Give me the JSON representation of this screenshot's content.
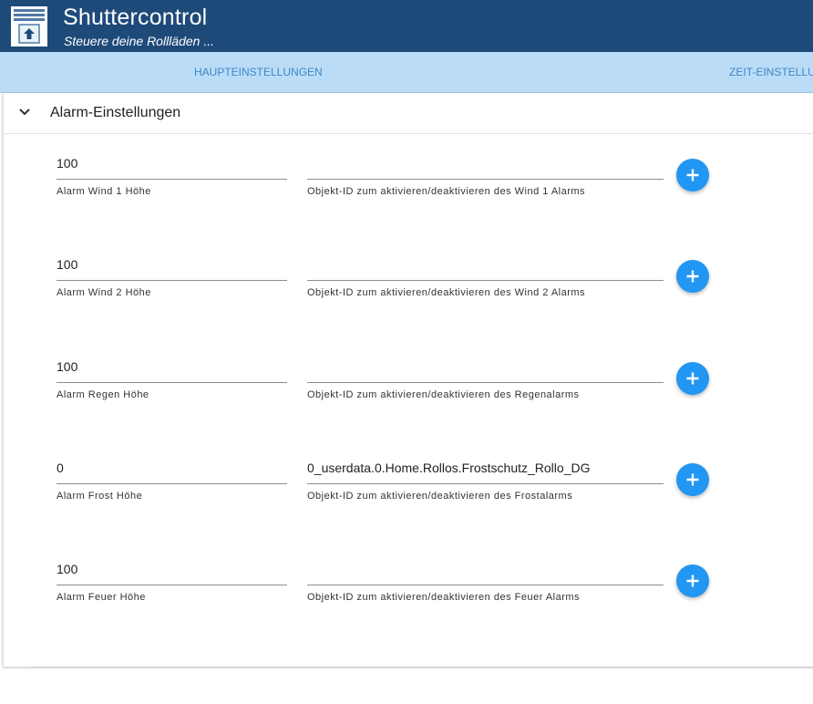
{
  "header": {
    "title": "Shuttercontrol",
    "subtitle": "Steuere deine Rollläden ..."
  },
  "tabs": [
    {
      "label": "HAUPTEINSTELLUNGEN"
    },
    {
      "label": "ZEIT-EINSTELLU"
    }
  ],
  "panel": {
    "title": "Alarm-Einstellungen",
    "rows": [
      {
        "height_value": "100",
        "height_label": "Alarm Wind 1 Höhe",
        "object_value": "",
        "object_label": "Objekt-ID zum aktivieren/deaktivieren des Wind 1 Alarms"
      },
      {
        "height_value": "100",
        "height_label": "Alarm Wind 2 Höhe",
        "object_value": "",
        "object_label": "Objekt-ID zum aktivieren/deaktivieren des Wind 2 Alarms"
      },
      {
        "height_value": "100",
        "height_label": "Alarm Regen Höhe",
        "object_value": "",
        "object_label": "Objekt-ID zum aktivieren/deaktivieren des Regenalarms"
      },
      {
        "height_value": "0",
        "height_label": "Alarm Frost Höhe",
        "object_value": "0_userdata.0.Home.Rollos.Frostschutz_Rollo_DG",
        "object_label": "Objekt-ID zum aktivieren/deaktivieren des Frostalarms"
      },
      {
        "height_value": "100",
        "height_label": "Alarm Feuer Höhe",
        "object_value": "",
        "object_label": "Objekt-ID zum aktivieren/deaktivieren des Feuer Alarms"
      }
    ]
  },
  "icons": {
    "logo": "window-shutter-icon",
    "expand": "chevron-down-icon",
    "add": "plus-icon"
  },
  "colors": {
    "header_bg": "#1e4a7a",
    "tabbar_bg": "#bbdcf7",
    "tab_text": "#3a88c9",
    "accent": "#2196f3"
  }
}
